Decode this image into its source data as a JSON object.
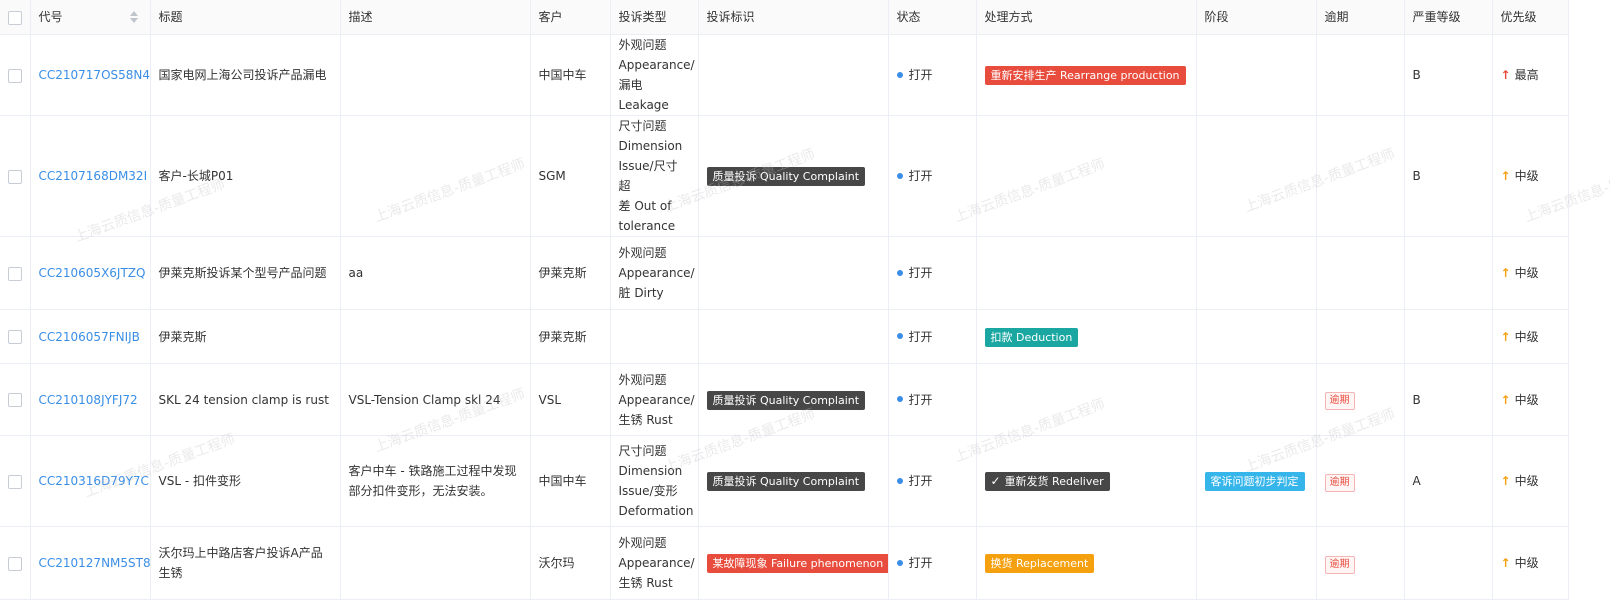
{
  "table": {
    "columns": {
      "code": "代号",
      "title": "标题",
      "desc": "描述",
      "customer": "客户",
      "type": "投诉类型",
      "mark": "投诉标识",
      "status": "状态",
      "handling": "处理方式",
      "stage": "阶段",
      "overdue": "逾期",
      "severity": "严重等级",
      "priority": "优先级"
    },
    "rows": [
      {
        "code": "CC210717OS58N4",
        "title": "国家电网上海公司投诉产品漏电",
        "desc": "",
        "customer": "中国中车",
        "type": [
          "外观问题",
          "Appearance/",
          "漏电 Leakage"
        ],
        "mark": "",
        "status": "打开",
        "handling": "重新安排生产 Rearrange production",
        "stage": "",
        "overdue": "",
        "severity": "B",
        "priority": "最高"
      },
      {
        "code": "CC2107168DM32I",
        "title": "客户-长城P01",
        "desc": "",
        "customer": "SGM",
        "type": [
          "尺寸问题",
          "Dimension",
          "Issue/尺寸超",
          "差 Out of",
          "tolerance"
        ],
        "mark": "质量投诉 Quality Complaint",
        "status": "打开",
        "handling": "",
        "stage": "",
        "overdue": "",
        "severity": "B",
        "priority": "中级"
      },
      {
        "code": "CC210605X6JTZQ",
        "title": "伊莱克斯投诉某个型号产品问题",
        "desc": "aa",
        "customer": "伊莱克斯",
        "type": [
          "外观问题",
          "Appearance/",
          "脏 Dirty"
        ],
        "mark": "",
        "status": "打开",
        "handling": "",
        "stage": "",
        "overdue": "",
        "severity": "",
        "priority": "中级"
      },
      {
        "code": "CC2106057FNIJB",
        "title": "伊莱克斯",
        "desc": "",
        "customer": "伊莱克斯",
        "type": [],
        "mark": "",
        "status": "打开",
        "handling": "扣款 Deduction",
        "stage": "",
        "overdue": "",
        "severity": "",
        "priority": "中级"
      },
      {
        "code": "CC210108JYFJ72",
        "title": "SKL 24 tension clamp is rust",
        "desc": "VSL-Tension Clamp skl 24",
        "customer": "VSL",
        "type": [
          "外观问题",
          "Appearance/",
          "生锈 Rust"
        ],
        "mark": "质量投诉 Quality Complaint",
        "status": "打开",
        "handling": "",
        "stage": "",
        "overdue": "逾期",
        "severity": "B",
        "priority": "中级"
      },
      {
        "code": "CC210316D79Y7C",
        "title": "VSL - 扣件变形",
        "desc": "客户中车 - 铁路施工过程中发现部分扣件变形，无法安装。",
        "customer": "中国中车",
        "type": [
          "尺寸问题",
          "Dimension",
          "Issue/变形",
          "Deformation"
        ],
        "mark": "质量投诉 Quality Complaint",
        "status": "打开",
        "handling": "重新发货 Redeliver",
        "stage": "客诉问题初步判定",
        "overdue": "逾期",
        "severity": "A",
        "priority": "中级"
      },
      {
        "code": "CC210127NM5ST8",
        "title": "沃尔玛上中路店客户投诉A产品生锈",
        "desc": "",
        "customer": "沃尔玛",
        "type": [
          "外观问题",
          "Appearance/",
          "生锈 Rust"
        ],
        "mark": "某故障现象 Failure phenomenon",
        "status": "打开",
        "handling": "换货 Replacement",
        "stage": "",
        "overdue": "逾期",
        "severity": "",
        "priority": "中级"
      }
    ]
  },
  "watermark": "上海云质信息-质量工程师",
  "colors": {
    "link": "#3a8ee6",
    "tag_dark": "#474747",
    "tag_red": "#e84c3d",
    "tag_teal": "#1aa7a1",
    "tag_orange": "#f5a00f",
    "tag_blue": "#36b5ea",
    "status_dot": "#3a8ee6",
    "priority_high": "#e84c3d",
    "priority_mid": "#f5a00f"
  }
}
